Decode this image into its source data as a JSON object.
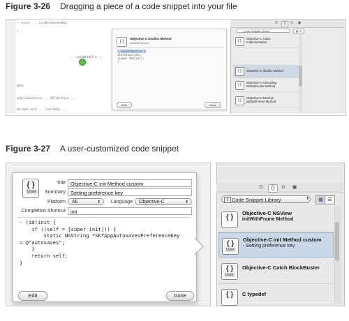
{
  "fig26": {
    "label": "Figure 3-26",
    "caption": "Dragging a piece of a code snippet into your file",
    "code_lines": [
      "- (void) ... initWithWindowNib",
      "}",
      "",
      "",
      "",
      "",
      "",
      "",
      "",
      "",
      "",
      "@end",
      "",
      "@implementation ... NSTableView ...",
      "",
      "#pragma mark ... LaunchBay ..."
    ],
    "drag_text": "... initWithFile ...",
    "popover": {
      "icon": "{ }",
      "title": "Objective-C Dealloc Method",
      "subtitle": "initWithParams",
      "code_lines": [
        "- (void)dealloc {",
        "  statsSecuriaty",
        "  [super dealloc];",
        "}"
      ],
      "edit": "Edit",
      "done": "Done"
    },
    "library": {
      "tabs": [
        "D",
        "{}",
        "⊙",
        "▣"
      ],
      "select": "Code Snippet Library",
      "items": [
        {
          "icon": "{ }",
          "line1": "Objective-C Class",
          "line2": "Implementation"
        },
        {
          "icon": "{ }",
          "line1": "Objective-C dealloc Method",
          "line2": ""
        },
        {
          "icon": "{ }",
          "line1": "Objective-C NSCoding",
          "line2": "initWithCoder Method"
        },
        {
          "icon": "{ }",
          "line1": "Objective-C NSView",
          "line2": "initWithFrame Method"
        }
      ]
    }
  },
  "fig27": {
    "label": "Figure 3-27",
    "caption": "A user-customized code snippet",
    "icon_braces": "{ }",
    "icon_badge": "User",
    "fields": {
      "title_label": "Title",
      "title_value": "Objective-C init Method custom",
      "summary_label": "Summary",
      "summary_value": "Setting preference key",
      "platform_label": "Platform",
      "platform_value": "All",
      "language_label": "Language",
      "language_value": "Objective-C",
      "shortcut_label": "Completion Shortcut",
      "shortcut_value": "init"
    },
    "code": "- (id)init {\n    if ((self = [super init])) {\n        static NSString *SKTAppAutosavesPreferenceKey\n= @\"autosaves\";\n    }\n    return self;\n}",
    "edit": "Edit",
    "done": "Done",
    "library": {
      "tabs": [
        "D",
        "{}",
        "⊙",
        "▣"
      ],
      "select": "Code Snippet Library",
      "items": [
        {
          "title": "Objective-C NSView",
          "sub": "initWithFrame Method",
          "user": false
        },
        {
          "title": "Objective-C init Method custom",
          "sub": "- Setting preference key",
          "user": true
        },
        {
          "title": "Objective-C Catch BlockBuster",
          "sub": "",
          "user": true
        },
        {
          "title": "C typedef",
          "sub": "",
          "user": false
        }
      ]
    }
  }
}
